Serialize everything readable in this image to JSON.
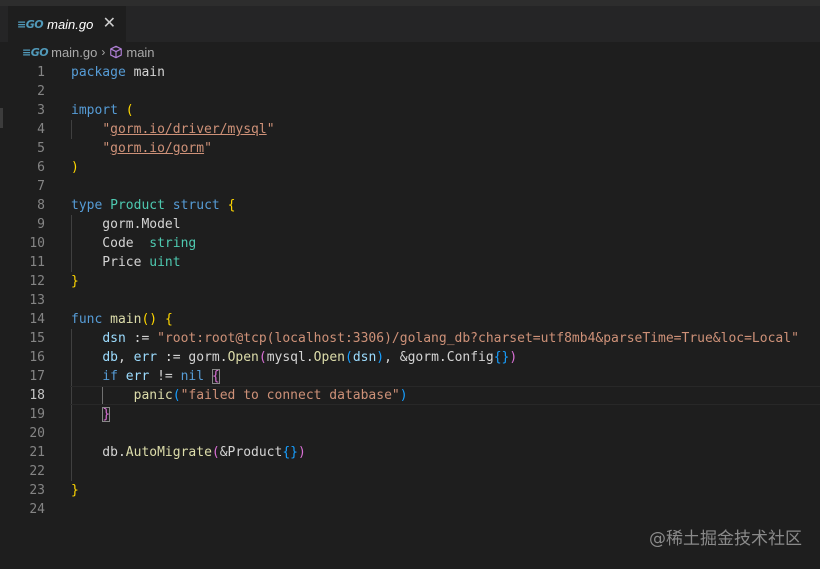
{
  "tab": {
    "title": "main.go",
    "close": "✕",
    "icon": "go-file-icon"
  },
  "breadcrumb": {
    "file": "main.go",
    "symbol": "main",
    "separator": "›"
  },
  "editor": {
    "current_line": 18,
    "lines": [
      {
        "n": "1",
        "tokens": [
          [
            "kw",
            "package"
          ],
          [
            "op",
            " main"
          ]
        ]
      },
      {
        "n": "2",
        "tokens": []
      },
      {
        "n": "3",
        "tokens": [
          [
            "kw",
            "import"
          ],
          [
            "op",
            " "
          ],
          [
            "b1",
            "("
          ]
        ]
      },
      {
        "n": "4",
        "tokens": [
          [
            "op",
            "    "
          ],
          [
            "str",
            "\""
          ],
          [
            "str u",
            "gorm.io/driver/mysql"
          ],
          [
            "str",
            "\""
          ]
        ]
      },
      {
        "n": "5",
        "tokens": [
          [
            "op",
            "    "
          ],
          [
            "str",
            "\""
          ],
          [
            "str u",
            "gorm.io/gorm"
          ],
          [
            "str",
            "\""
          ]
        ]
      },
      {
        "n": "6",
        "tokens": [
          [
            "b1",
            ")"
          ]
        ]
      },
      {
        "n": "7",
        "tokens": []
      },
      {
        "n": "8",
        "tokens": [
          [
            "kw",
            "type"
          ],
          [
            "op",
            " "
          ],
          [
            "ty",
            "Product"
          ],
          [
            "op",
            " "
          ],
          [
            "kw",
            "struct"
          ],
          [
            "op",
            " "
          ],
          [
            "b1",
            "{"
          ]
        ]
      },
      {
        "n": "9",
        "tokens": [
          [
            "op",
            "    gorm.Model"
          ]
        ]
      },
      {
        "n": "10",
        "tokens": [
          [
            "op",
            "    Code  "
          ],
          [
            "ty",
            "string"
          ]
        ]
      },
      {
        "n": "11",
        "tokens": [
          [
            "op",
            "    Price "
          ],
          [
            "ty",
            "uint"
          ]
        ]
      },
      {
        "n": "12",
        "tokens": [
          [
            "b1",
            "}"
          ]
        ]
      },
      {
        "n": "13",
        "tokens": []
      },
      {
        "n": "14",
        "tokens": [
          [
            "kw",
            "func"
          ],
          [
            "op",
            " "
          ],
          [
            "fn",
            "main"
          ],
          [
            "b1",
            "()"
          ],
          [
            "op",
            " "
          ],
          [
            "b1",
            "{"
          ]
        ]
      },
      {
        "n": "15",
        "tokens": [
          [
            "op",
            "    "
          ],
          [
            "var",
            "dsn"
          ],
          [
            "op",
            " := "
          ],
          [
            "str",
            "\"root:root@tcp(localhost:3306)/golang_db?charset=utf8mb4&parseTime=True&loc=Local\""
          ]
        ]
      },
      {
        "n": "16",
        "tokens": [
          [
            "op",
            "    "
          ],
          [
            "var",
            "db"
          ],
          [
            "op",
            ", "
          ],
          [
            "var",
            "err"
          ],
          [
            "op",
            " := gorm."
          ],
          [
            "fn",
            "Open"
          ],
          [
            "b2",
            "("
          ],
          [
            "op",
            "mysql."
          ],
          [
            "fn",
            "Open"
          ],
          [
            "b3",
            "("
          ],
          [
            "var",
            "dsn"
          ],
          [
            "b3",
            ")"
          ],
          [
            "op",
            ", &gorm.Config"
          ],
          [
            "b3",
            "{}"
          ],
          [
            "b2",
            ")"
          ]
        ]
      },
      {
        "n": "17",
        "tokens": [
          [
            "op",
            "    "
          ],
          [
            "kw",
            "if"
          ],
          [
            "op",
            " "
          ],
          [
            "var",
            "err"
          ],
          [
            "op",
            " != "
          ],
          [
            "kw",
            "nil"
          ],
          [
            "op",
            " "
          ],
          [
            "b2 boxbr",
            "{"
          ]
        ]
      },
      {
        "n": "18",
        "tokens": [
          [
            "op",
            "        "
          ],
          [
            "fn",
            "panic"
          ],
          [
            "b3",
            "("
          ],
          [
            "str",
            "\"failed to connect database\""
          ],
          [
            "b3",
            ")"
          ]
        ]
      },
      {
        "n": "19",
        "tokens": [
          [
            "op",
            "    "
          ],
          [
            "b2 boxbr",
            "}"
          ]
        ]
      },
      {
        "n": "20",
        "tokens": []
      },
      {
        "n": "21",
        "tokens": [
          [
            "op",
            "    db."
          ],
          [
            "fn",
            "AutoMigrate"
          ],
          [
            "b2",
            "("
          ],
          [
            "op",
            "&Product"
          ],
          [
            "b3",
            "{}"
          ],
          [
            "b2",
            ")"
          ]
        ]
      },
      {
        "n": "22",
        "tokens": []
      },
      {
        "n": "23",
        "tokens": [
          [
            "b1",
            "}"
          ]
        ]
      },
      {
        "n": "24",
        "tokens": []
      }
    ]
  },
  "watermark": "@稀土掘金技术社区",
  "colors": {
    "background": "#1e1e1e",
    "tabbar": "#252526",
    "keyword": "#569cd6",
    "type": "#4ec9b0",
    "function": "#dcdcaa",
    "string": "#ce9178"
  }
}
